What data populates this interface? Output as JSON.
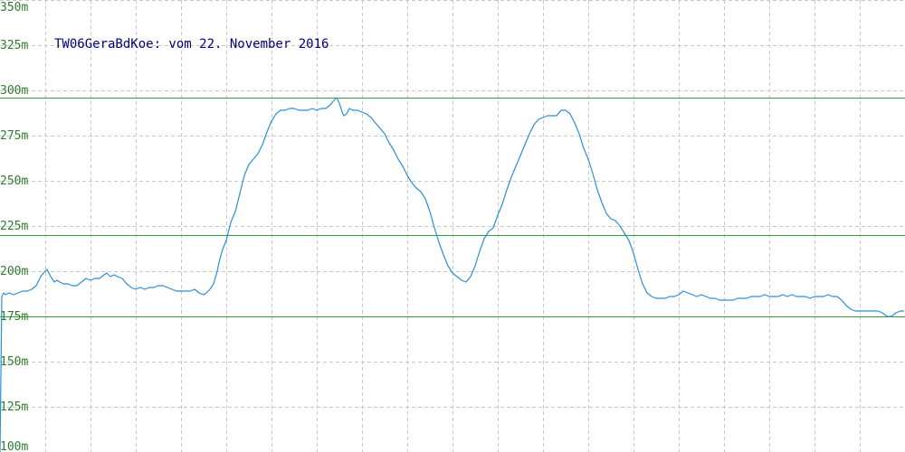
{
  "chart_data": {
    "type": "line",
    "title": "TW06GeraBdKoe: vom 22. November 2016",
    "xlabel": "",
    "ylabel": "",
    "ylim": [
      100,
      350
    ],
    "y_ticks": [
      "100m",
      "125m",
      "150m",
      "175m",
      "200m",
      "225m",
      "250m",
      "275m",
      "300m",
      "325m",
      "350m"
    ],
    "y_tick_values": [
      100,
      125,
      150,
      175,
      200,
      225,
      250,
      275,
      300,
      325,
      350
    ],
    "grid": true,
    "x_gridlines": 20,
    "reference_lines": [
      296,
      220,
      175
    ],
    "colors": {
      "line": "#2a8fd8",
      "grid": "#c8c8c8",
      "reference": "#3a9a3a",
      "tick_label": "#2e7d2e",
      "title": "#00007a"
    },
    "series": [
      {
        "x": [
          0,
          2,
          4,
          6,
          10,
          15,
          20,
          25,
          30,
          35,
          40,
          45,
          48,
          52,
          56,
          60,
          63,
          66,
          70,
          75,
          80,
          85,
          90,
          95,
          100,
          105,
          110,
          115,
          118,
          122,
          126,
          130,
          135,
          140,
          145,
          150,
          155,
          160,
          165,
          170,
          175,
          180,
          185,
          190,
          195,
          200,
          205,
          210,
          215,
          220,
          225,
          228,
          232,
          236,
          240,
          243,
          246,
          250,
          255,
          260,
          265,
          270,
          275,
          280,
          285,
          290,
          295,
          300,
          305,
          310,
          315,
          320,
          325,
          330,
          335,
          340,
          345,
          350,
          355,
          360,
          365,
          368,
          372,
          375,
          378,
          380,
          383,
          386,
          390,
          395,
          400,
          405,
          410,
          415,
          420,
          425,
          430,
          435,
          440,
          445,
          450,
          455,
          460,
          465,
          470,
          475,
          480,
          485,
          490,
          495,
          500,
          505,
          510,
          515,
          520,
          525,
          530,
          535,
          540,
          545,
          550,
          555,
          560,
          565,
          570,
          575,
          580,
          585,
          590,
          595,
          600,
          605,
          610,
          615,
          620,
          625,
          630,
          635,
          640,
          645,
          650,
          655,
          660,
          665,
          670,
          675,
          680,
          685,
          690,
          695,
          700,
          705,
          710,
          715,
          720,
          725,
          730,
          735,
          740,
          745,
          750,
          755,
          760,
          765,
          770,
          775,
          780,
          785,
          790,
          795,
          800,
          805,
          810,
          815,
          820,
          825,
          830,
          835,
          840,
          845,
          850,
          855,
          860,
          865,
          870,
          875,
          880,
          885,
          890,
          895,
          900,
          905,
          910,
          915,
          920,
          925,
          930,
          935,
          940,
          945,
          950,
          955,
          960,
          965,
          970,
          975,
          980,
          985,
          990,
          995,
          999
        ],
        "y": [
          100,
          186,
          188,
          187,
          188,
          187,
          188,
          189,
          189,
          190,
          192,
          197,
          199,
          201,
          197,
          194,
          195,
          194,
          193,
          193,
          192,
          192,
          194,
          196,
          195,
          196,
          196,
          198,
          199,
          197,
          198,
          197,
          196,
          193,
          191,
          190,
          191,
          190,
          191,
          191,
          192,
          192,
          191,
          190,
          189,
          189,
          189,
          189,
          190,
          188,
          187,
          188,
          190,
          193,
          200,
          207,
          212,
          217,
          227,
          233,
          243,
          253,
          259,
          262,
          265,
          270,
          277,
          283,
          287,
          289,
          289,
          290,
          290,
          289,
          289,
          289,
          290,
          289,
          290,
          290,
          292,
          294,
          296,
          293,
          288,
          286,
          287,
          290,
          289,
          289,
          288,
          287,
          285,
          282,
          279,
          276,
          271,
          267,
          262,
          258,
          253,
          249,
          246,
          244,
          240,
          233,
          224,
          216,
          209,
          203,
          199,
          197,
          195,
          194,
          197,
          203,
          211,
          218,
          222,
          224,
          231,
          237,
          245,
          252,
          258,
          264,
          270,
          276,
          281,
          284,
          285,
          286,
          286,
          286,
          289,
          289,
          287,
          282,
          276,
          268,
          262,
          254,
          245,
          238,
          232,
          229,
          228,
          225,
          221,
          217,
          210,
          201,
          193,
          188,
          186,
          185,
          185,
          185,
          186,
          186,
          187,
          189,
          188,
          187,
          186,
          187,
          186,
          185,
          185,
          184,
          184,
          184,
          184,
          185,
          185,
          185,
          186,
          186,
          186,
          187,
          186,
          186,
          186,
          187,
          186,
          187,
          186,
          186,
          186,
          185,
          186,
          186,
          186,
          187,
          186,
          186,
          184,
          181,
          179,
          178,
          178,
          178,
          178,
          178,
          178,
          177,
          175,
          175,
          177,
          178,
          178
        ]
      }
    ]
  }
}
